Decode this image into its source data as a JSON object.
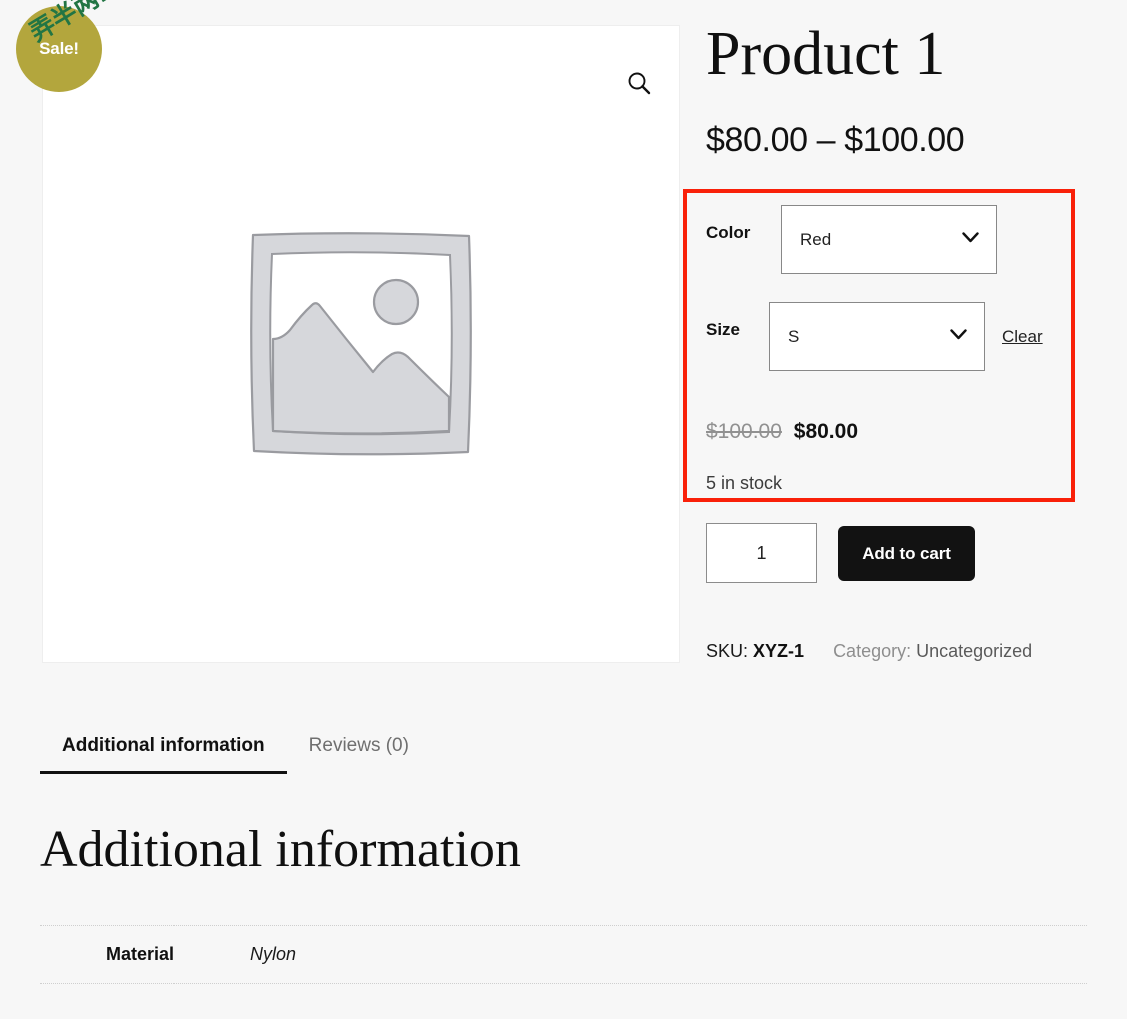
{
  "badge": {
    "sale_label": "Sale!",
    "watermark_text": "弄半两.com",
    "badge_color": "#b3a63d",
    "watermark_color": "#227544"
  },
  "gallery": {
    "zoom_icon": "search-icon",
    "placeholder_alt": "Awaiting product image"
  },
  "summary": {
    "title": "Product 1",
    "price_range": "$80.00 – $100.00"
  },
  "variations": {
    "highlight_color": "#f92009",
    "attributes": [
      {
        "label": "Color",
        "selected": "Red",
        "options": [
          "Red"
        ]
      },
      {
        "label": "Size",
        "selected": "S",
        "options": [
          "S"
        ]
      }
    ],
    "clear_label": "Clear",
    "regular_price": "$100.00",
    "sale_price": "$80.00",
    "stock_status": "5 in stock"
  },
  "cart": {
    "quantity": "1",
    "quantity_placeholder": "1",
    "add_to_cart_label": "Add to cart"
  },
  "meta": {
    "sku_label": "SKU:",
    "sku_value": "XYZ-1",
    "category_label": "Category:",
    "category_value": "Uncategorized"
  },
  "tabs": [
    {
      "label": "Additional information",
      "active": true
    },
    {
      "label": "Reviews (0)",
      "active": false
    }
  ],
  "additional_information": {
    "heading": "Additional information",
    "rows": [
      {
        "name": "Material",
        "value": "Nylon"
      }
    ]
  }
}
